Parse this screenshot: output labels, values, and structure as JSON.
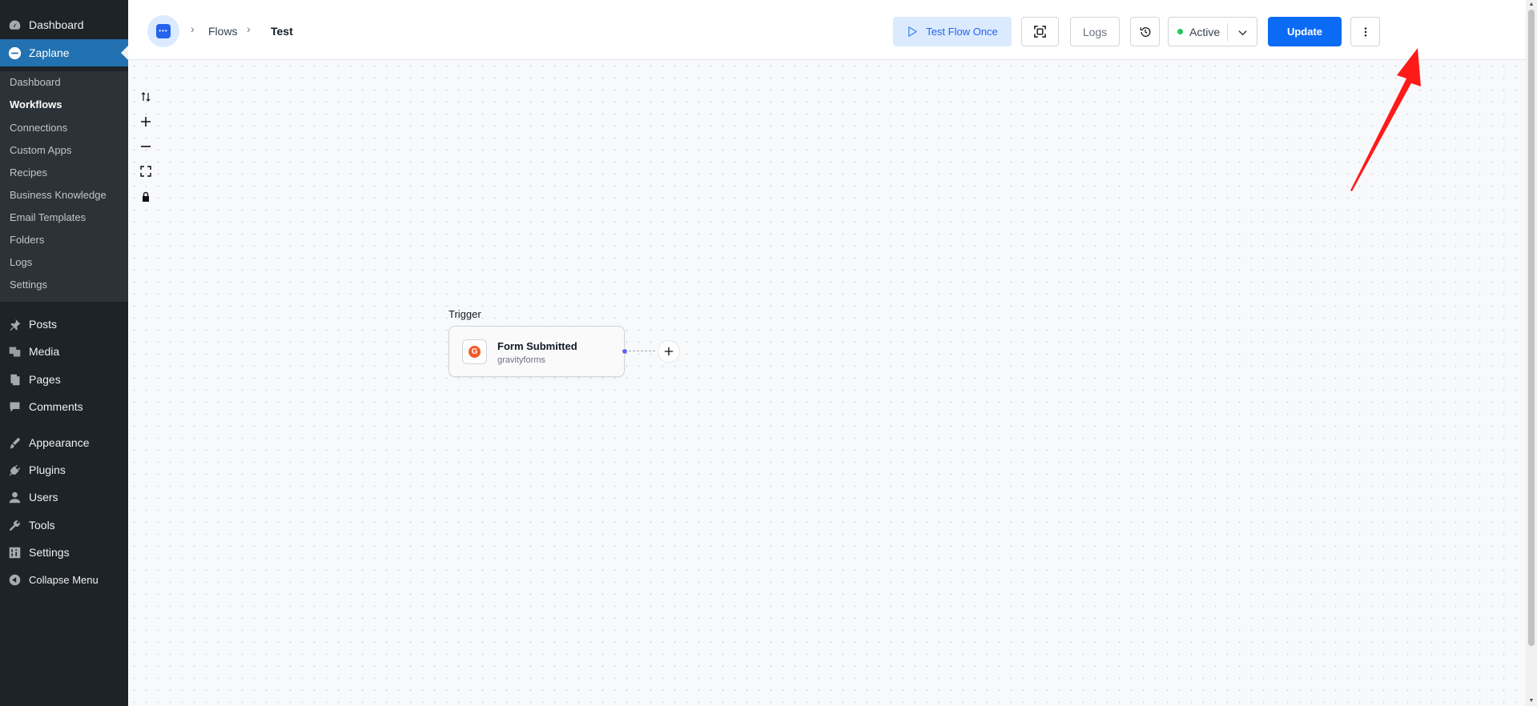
{
  "wp_menu": {
    "dashboard": "Dashboard",
    "zaplane": "Zaplane",
    "posts": "Posts",
    "media": "Media",
    "pages": "Pages",
    "comments": "Comments",
    "appearance": "Appearance",
    "plugins": "Plugins",
    "users": "Users",
    "tools": "Tools",
    "settings": "Settings",
    "collapse": "Collapse Menu"
  },
  "submenu": {
    "dashboard": "Dashboard",
    "workflows": "Workflows",
    "connections": "Connections",
    "custom_apps": "Custom Apps",
    "recipes": "Recipes",
    "business_knowledge": "Business Knowledge",
    "email_templates": "Email Templates",
    "folders": "Folders",
    "logs": "Logs",
    "settings": "Settings"
  },
  "breadcrumb": {
    "flows": "Flows",
    "current": "Test"
  },
  "toolbar": {
    "test_flow_once": "Test Flow Once",
    "logs": "Logs",
    "status": "Active",
    "update": "Update"
  },
  "node": {
    "section_label": "Trigger",
    "title": "Form Submitted",
    "app": "gravityforms"
  },
  "colors": {
    "sidebar_bg": "#1d2327",
    "wp_accent": "#2271b1",
    "update_button": "#0b6bf5",
    "test_button_bg": "#dbeafe",
    "status_active": "#22c55e",
    "arrow": "#ff1a1a"
  },
  "icons": {
    "wp_dashboard": "gauge-icon",
    "wp_zaplane": "zaplane-logo-icon",
    "wp_posts": "pin-icon",
    "wp_media": "media-icon",
    "wp_pages": "pages-icon",
    "wp_comments": "comment-icon",
    "wp_appearance": "brush-icon",
    "wp_plugins": "plug-icon",
    "wp_users": "user-icon",
    "wp_tools": "wrench-icon",
    "wp_settings": "sliders-icon",
    "wp_collapse": "collapse-arrow-icon"
  }
}
